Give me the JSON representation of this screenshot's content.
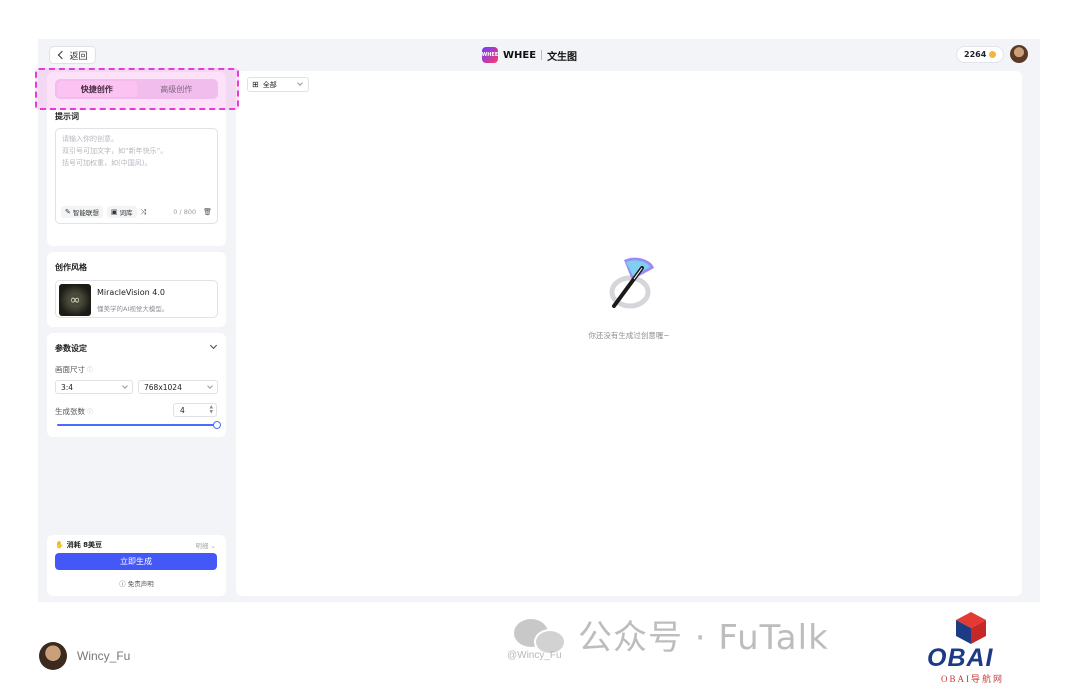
{
  "header": {
    "back_label": "返回",
    "brand_name": "WHEE",
    "logo_text": "WHEE",
    "page_title": "文生图",
    "credits": "2264"
  },
  "tabs": [
    {
      "label": "快捷创作",
      "active": true
    },
    {
      "label": "高级创作",
      "active": false
    }
  ],
  "prompt": {
    "title": "提示词",
    "placeholder_lines": [
      "请输入你的创意。",
      "双引号可加文字，如“新年快乐”。",
      "括号可加权重，如(中国风)。"
    ],
    "smart_assoc_label": "智能联想",
    "library_label": "词库",
    "counter": "0 / 800"
  },
  "style": {
    "title": "创作风格",
    "model_name": "MiracleVision 4.0",
    "model_desc": "懂美学的AI视觉大模型。"
  },
  "params": {
    "title": "参数设定",
    "size_label": "画面尺寸",
    "ratio": "3:4",
    "resolution": "768x1024",
    "count_label": "生成张数",
    "count": "4",
    "slider_fraction": 1.0
  },
  "generate": {
    "cost": "消耗 8美豆",
    "detail": "明细",
    "button": "立即生成",
    "disclaimer": "免责声明"
  },
  "main": {
    "filter_label": "全部",
    "empty_text": "你还没有生成过创意喔~"
  },
  "footer": {
    "author": "Wincy_Fu",
    "handle": "@Wincy_Fu",
    "watermark": "公众号 · FuTalk",
    "obai": "OBAI",
    "obai_sub": "OBAI导航网"
  },
  "colors": {
    "accent": "#4458f8",
    "highlight": "#e63ad9"
  }
}
